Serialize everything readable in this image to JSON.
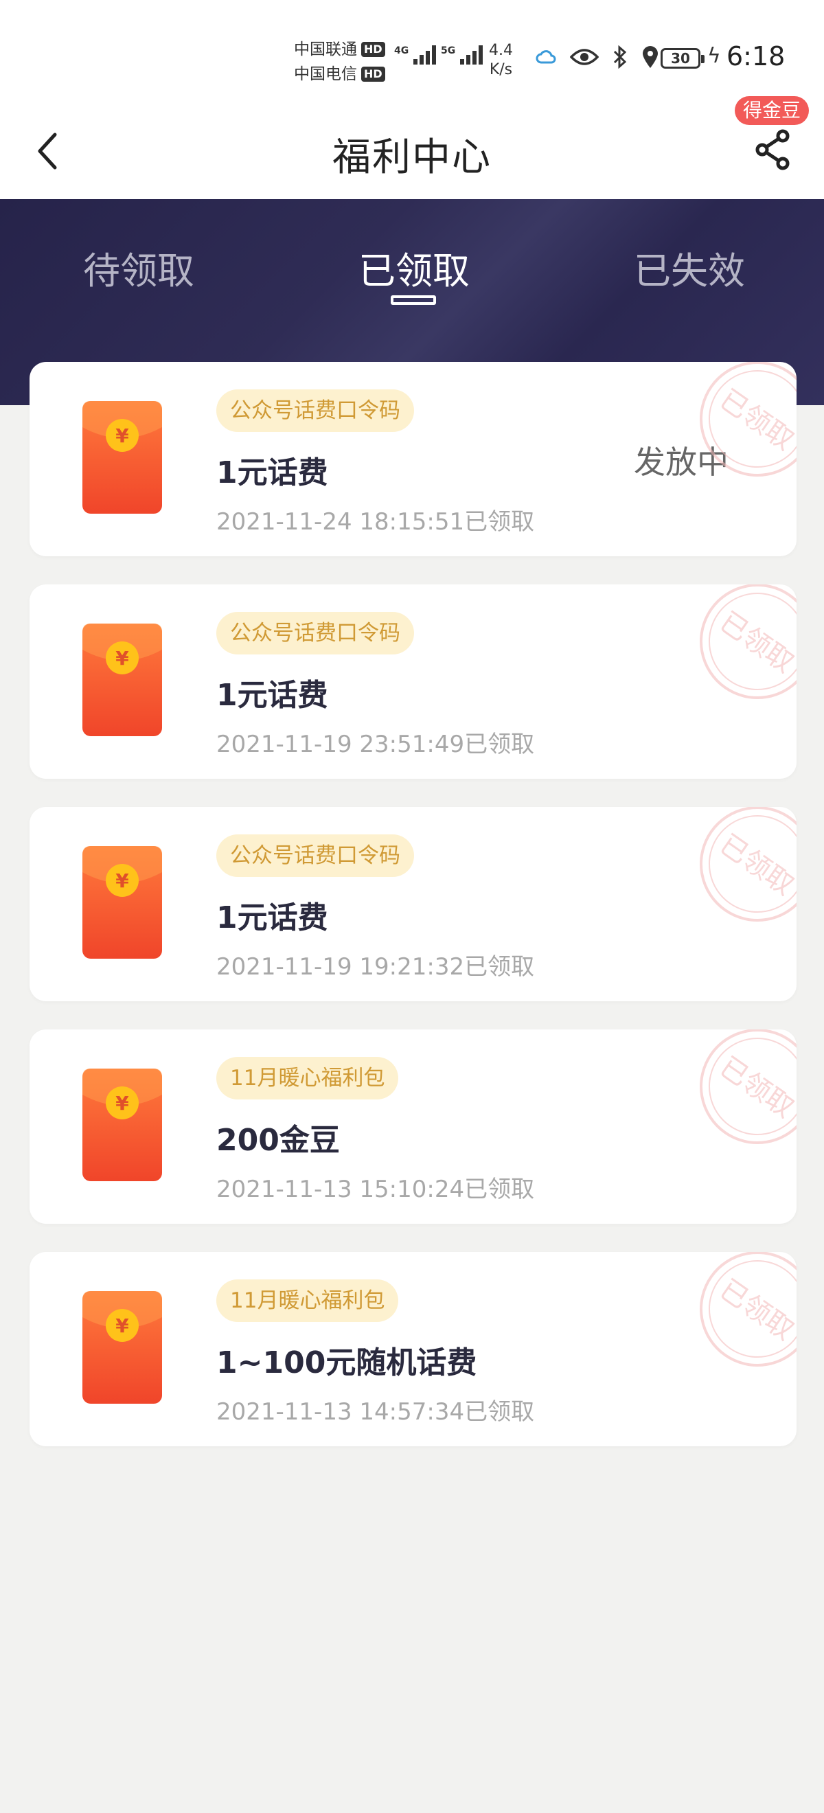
{
  "status_bar": {
    "carrier_1": "中国联通",
    "carrier_2": "中国电信",
    "hd": "HD",
    "net_1": "4G",
    "net_2": "5G",
    "speed_value": "4.4",
    "speed_unit": "K/s",
    "battery": "30",
    "time": "6:18"
  },
  "header": {
    "title": "福利中心",
    "badge": "得金豆"
  },
  "tabs": [
    {
      "label": "待领取",
      "active": false
    },
    {
      "label": "已领取",
      "active": true
    },
    {
      "label": "已失效",
      "active": false
    }
  ],
  "colors": {
    "banner": "#2b2850",
    "pill_bg": "#fdf1cf",
    "pill_text": "#d09a35",
    "packet": "#f0542c",
    "coin": "#ffc21a",
    "badge": "#f25a58",
    "stamp": "#f3c2c2"
  },
  "stamp_text": "已领取",
  "items": [
    {
      "tag": "公众号话费口令码",
      "title": "1元话费",
      "time": "2021-11-24 18:15:51已领取",
      "status": "发放中"
    },
    {
      "tag": "公众号话费口令码",
      "title": "1元话费",
      "time": "2021-11-19 23:51:49已领取",
      "status": ""
    },
    {
      "tag": "公众号话费口令码",
      "title": "1元话费",
      "time": "2021-11-19 19:21:32已领取",
      "status": ""
    },
    {
      "tag": "11月暖心福利包",
      "title": "200金豆",
      "time": "2021-11-13 15:10:24已领取",
      "status": ""
    },
    {
      "tag": "11月暖心福利包",
      "title": "1~100元随机话费",
      "time": "2021-11-13 14:57:34已领取",
      "status": ""
    }
  ]
}
